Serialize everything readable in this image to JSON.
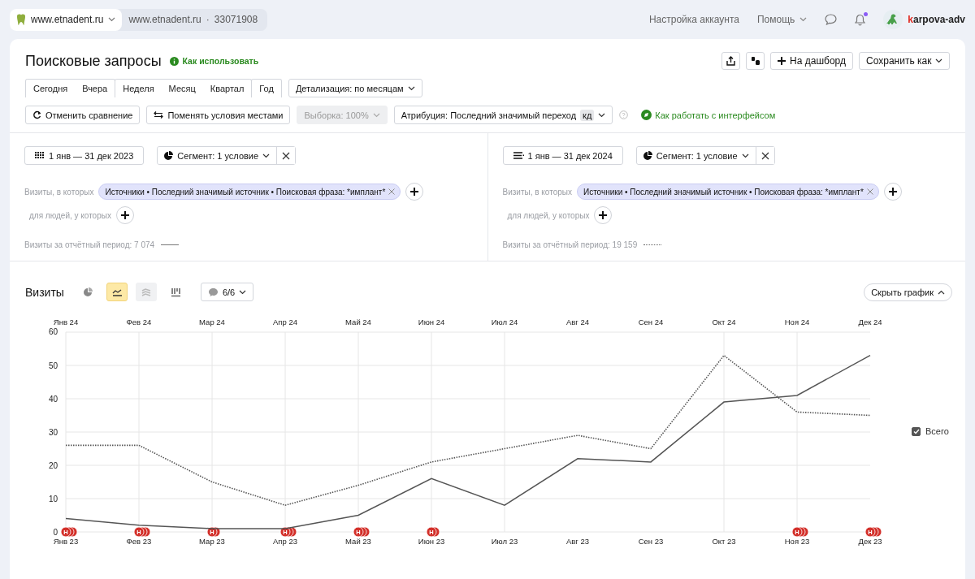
{
  "top_bar": {
    "site_selector": "www.etnadent.ru",
    "counter_site": "www.etnadent.ru",
    "counter_separator": "·",
    "counter_id": "33071908",
    "links": [
      "Настройка аккаунта",
      "Помощь"
    ],
    "notifications_unread": true,
    "login_first_letter": "k",
    "login_rest": "arpova-adv"
  },
  "header": {
    "title": "Поисковые запросы",
    "help_link": "Как использовать",
    "actions": [
      {
        "kind": "share"
      },
      {
        "kind": "dots"
      },
      {
        "kind": "add",
        "label": "На дашборд"
      },
      {
        "kind": "dropdown",
        "label": "Сохранить как"
      }
    ]
  },
  "period_groups": [
    [
      {
        "label": "Сегодня",
        "selected": false
      },
      {
        "label": "Вчера",
        "selected": false
      }
    ],
    [
      {
        "label": "Неделя",
        "selected": false
      },
      {
        "label": "Месяц",
        "selected": false
      },
      {
        "label": "Квартал",
        "selected": false
      }
    ],
    [
      {
        "label": "Год",
        "selected": false
      }
    ]
  ],
  "detail_dropdown": "Детализация: по месяцам",
  "toolbar": {
    "cancel_compare": "Отменить сравнение",
    "swap": "Поменять условия местами",
    "sample": {
      "label": "Выборка: 100%",
      "disabled": true
    },
    "attribution": {
      "label": "Атрибуция: Последний значимый переход",
      "badge": "кд"
    },
    "interface_link": "Как работать с интерфейсом"
  },
  "comparison": [
    {
      "period": "1 янв — 31 дек 2023",
      "kind": "dots",
      "segment": "Сегмент: 1 условие",
      "visits_label": "Визиты, в которых",
      "condition": "Источники • Последний значимый источник • Поисковая фраза: *имплант*",
      "people_label": "для людей, у которых",
      "total": "Визиты за отчётный период: 7 074"
    },
    {
      "period": "1 янв — 31 дек 2024",
      "kind": "lines",
      "segment": "Сегмент: 1 условие",
      "visits_label": "Визиты, в которых",
      "condition": "Источники • Последний значимый источник • Поисковая фраза: *имплант*",
      "people_label": "для людей, у которых",
      "total": "Визиты за отчётный период: 19 159"
    }
  ],
  "chart_panel": {
    "title": "Визиты",
    "views": [
      {
        "kind": "pie",
        "selected": false,
        "disabled": false
      },
      {
        "kind": "line",
        "selected": true,
        "disabled": false
      },
      {
        "kind": "area",
        "selected": false,
        "disabled": true
      },
      {
        "kind": "bars",
        "selected": false,
        "disabled": false
      }
    ],
    "notes": "6/6",
    "hide_button": "Скрыть график",
    "legend": {
      "label": "Всего",
      "checked": true
    },
    "chart_data": {
      "type": "line",
      "categories": [
        "Янв 24",
        "Фев 24",
        "Мар 24",
        "Апр 24",
        "Май 24",
        "Июн 24",
        "Июл 24",
        "Авг 24",
        "Сен 24",
        "Окт 24",
        "Ноя 24",
        "Дек 24"
      ],
      "ylim": [
        0,
        60
      ],
      "yticks": [
        0,
        10,
        20,
        30,
        40,
        50,
        60
      ],
      "grid": true,
      "series": [
        {
          "color": "#555555",
          "line_style": "solid",
          "values": [
            4,
            2,
            1,
            1,
            5,
            16,
            8,
            22,
            21,
            39,
            41,
            53
          ]
        },
        {
          "color": "#555555",
          "line_style": "dotted",
          "values": [
            26,
            26,
            15,
            8,
            14,
            21,
            25,
            29,
            25,
            53,
            36,
            35
          ]
        }
      ],
      "annotations": [
        {
          "x": "Янв 24",
          "text": "Н"
        },
        {
          "x": "Янв 24"
        },
        {
          "x": "Янв 24"
        },
        {
          "x": "Фев 24",
          "text": "Н"
        },
        {
          "x": "Фев 24"
        },
        {
          "x": "Фев 24"
        },
        {
          "x": "Мар 24",
          "text": "Н"
        },
        {
          "x": "Мар 24"
        },
        {
          "x": "Апр 24",
          "text": "Н"
        },
        {
          "x": "Апр 24"
        },
        {
          "x": "Апр 24"
        },
        {
          "x": "Май 24",
          "text": "Н"
        },
        {
          "x": "Май 24"
        },
        {
          "x": "Май 24"
        },
        {
          "x": "Июн 24",
          "text": "Н"
        },
        {
          "x": "Июн 24"
        },
        {
          "x": "Ноя 24",
          "text": "Н"
        },
        {
          "x": "Ноя 24"
        },
        {
          "x": "Ноя 24"
        },
        {
          "x": "Дек 24",
          "text": "Н"
        },
        {
          "x": "Дек 24"
        },
        {
          "x": "Дек 24"
        }
      ]
    },
    "comparison_axis_labels": [
      "Янв 23",
      "Фев 23",
      "Мар 23",
      "Апр 23",
      "Май 23",
      "Июн 23",
      "Июл 23",
      "Авг 23",
      "Сен 23",
      "Окт 23",
      "Ноя 23",
      "Дек 23"
    ]
  }
}
